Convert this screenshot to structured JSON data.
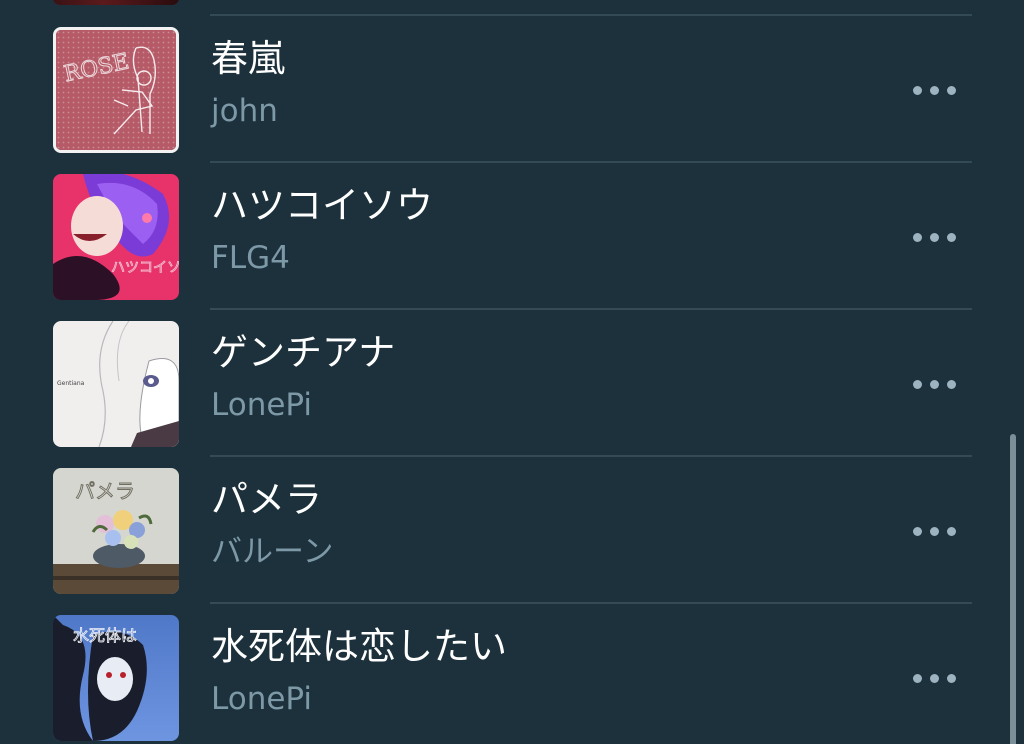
{
  "songs": [
    {
      "title": "春嵐",
      "artist": "john",
      "artwork": "rose-cover"
    },
    {
      "title": "ハツコイソウ",
      "artist": "FLG4",
      "artwork": "hatsukoisou-cover"
    },
    {
      "title": "ゲンチアナ",
      "artist": "LonePi",
      "artwork": "gentiana-cover"
    },
    {
      "title": "パメラ",
      "artist": "バルーン",
      "artwork": "pamela-cover"
    },
    {
      "title": "水死体は恋したい",
      "artist": "LonePi",
      "artwork": "suishitai-cover"
    }
  ],
  "artwork_text": {
    "rose": "ROSE",
    "gentiana": "Gentiana",
    "pamela": "パメラ",
    "hatsukoisou": "ハツコイソウ",
    "suishitai": "水死体は"
  },
  "more_icon": "ellipsis-icon",
  "colors": {
    "background": "#1c313b",
    "divider": "#344a55",
    "title": "#ffffff",
    "artist": "#7d98a6",
    "more_dots": "#9db3c0"
  }
}
